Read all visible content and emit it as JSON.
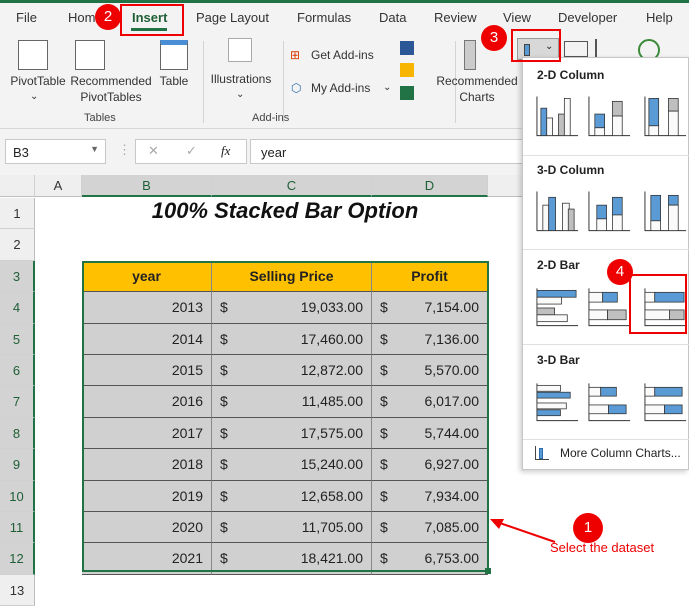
{
  "ribbon": {
    "tabs": [
      "File",
      "Home",
      "Insert",
      "Page Layout",
      "Formulas",
      "Data",
      "Review",
      "View",
      "Developer",
      "Help"
    ],
    "active_tab": "Insert",
    "tables_group": {
      "label": "Tables",
      "pivot": "PivotTable",
      "recommended_pivot_1": "Recommended",
      "recommended_pivot_2": "PivotTables",
      "table": "Table"
    },
    "illustrations": "Illustrations",
    "addins_group": {
      "label": "Add-ins",
      "get": "Get Add-ins",
      "my": "My Add-ins"
    },
    "recommended_charts_1": "Recommended",
    "recommended_charts_2": "Charts"
  },
  "formula_bar": {
    "name_box": "B3",
    "formula": "year",
    "fx": "fx"
  },
  "columns": [
    "A",
    "B",
    "C",
    "D"
  ],
  "rows": [
    "1",
    "2",
    "3",
    "4",
    "5",
    "6",
    "7",
    "8",
    "9",
    "10",
    "11",
    "12",
    "13"
  ],
  "sheet": {
    "title": "100% Stacked Bar Option",
    "headers": [
      "year",
      "Selling Price",
      "Profit"
    ],
    "currency": "$",
    "data": [
      [
        "2013",
        "19,033.00",
        "7,154.00"
      ],
      [
        "2014",
        "17,460.00",
        "7,136.00"
      ],
      [
        "2015",
        "12,872.00",
        "5,570.00"
      ],
      [
        "2016",
        "11,485.00",
        "6,017.00"
      ],
      [
        "2017",
        "17,575.00",
        "5,744.00"
      ],
      [
        "2018",
        "15,240.00",
        "6,927.00"
      ],
      [
        "2019",
        "12,658.00",
        "7,934.00"
      ],
      [
        "2020",
        "11,705.00",
        "7,085.00"
      ],
      [
        "2021",
        "18,421.00",
        "6,753.00"
      ]
    ]
  },
  "chart_menu": {
    "sections": [
      "2-D Column",
      "3-D Column",
      "2-D Bar",
      "3-D Bar"
    ],
    "more": "More Column Charts..."
  },
  "annotations": {
    "step1": "1",
    "step2": "2",
    "step3": "3",
    "step4": "4",
    "note": "Select the dataset"
  },
  "colors": {
    "accent": "#217346",
    "header_fill": "#ffc000",
    "data_fill": "#d0d0d0",
    "callout": "#e00000"
  }
}
